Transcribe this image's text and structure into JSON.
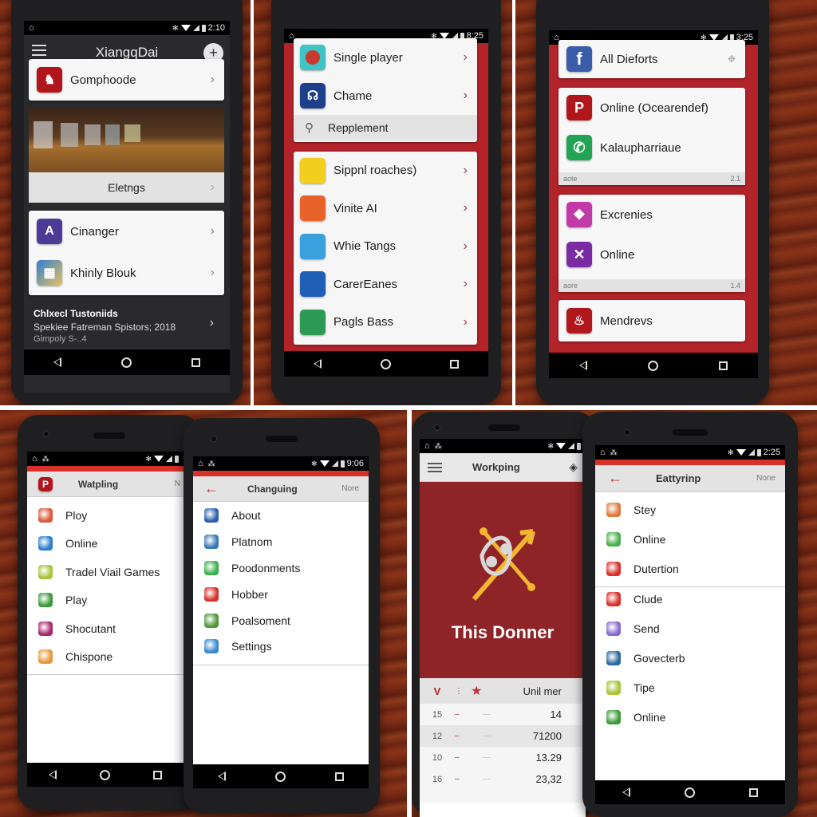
{
  "phones": {
    "p1": {
      "status": {
        "time": "2:10"
      },
      "header": {
        "title": "XiangqDai",
        "add_label": "+"
      },
      "top_item": {
        "label": "Gomphoode",
        "icon": "game-logo-icon"
      },
      "banner_button": {
        "label": "Eletngs"
      },
      "list": [
        {
          "label": "Cinanger",
          "icon": "compass-icon"
        },
        {
          "label": "Khinly Blouk",
          "icon": "board-icon"
        }
      ],
      "footer": {
        "title": "Chlxecl Tustoniids",
        "line1": "Spekiee Fatreman Spistors; 2018",
        "line2": "Gimpoly S-..4"
      }
    },
    "p2": {
      "status": {
        "time": "8:25"
      },
      "group1": [
        {
          "label": "Single player",
          "icon": "single-player-icon",
          "color": "#3ec4c4"
        },
        {
          "label": "Chame",
          "icon": "chame-icon",
          "color": "#1e3f8a"
        }
      ],
      "search_row": {
        "label": "Repplement"
      },
      "group2": [
        {
          "label": "Sippnl roaches)",
          "icon": "person-icon",
          "color": "#f2cf1d"
        },
        {
          "label": "Vinite AI",
          "icon": "cloud-icon",
          "color": "#e8632a"
        },
        {
          "label": "Whie Tangs",
          "icon": "orb-icon",
          "color": "#3aa0de"
        },
        {
          "label": "CarerEanes",
          "icon": "star-icon",
          "color": "#1f5fb5"
        },
        {
          "label": "Pagls Bass",
          "icon": "mountain-icon",
          "color": "#2c9a55"
        }
      ]
    },
    "p3": {
      "status": {
        "time": "3:25"
      },
      "card1": {
        "label": "All Dieforts",
        "icon": "facebook-icon"
      },
      "card2": {
        "items": [
          {
            "label": "Online (Ocearendef)",
            "icon": "p-icon",
            "glyph": "P",
            "color": "#b0161c"
          },
          {
            "label": "Kalaupharriaue",
            "icon": "phone-icon",
            "glyph": "✆",
            "color": "#23a455"
          }
        ],
        "footer_left": "aote",
        "footer_right": "2.1"
      },
      "card3": {
        "items": [
          {
            "label": "Excrenies",
            "icon": "shield-icon",
            "glyph": "❖",
            "color": "#c23aa8"
          },
          {
            "label": "Online",
            "icon": "cross-icon",
            "glyph": "✕",
            "color": "#7a2aa3"
          }
        ],
        "footer_left": "aore",
        "footer_right": "1.4"
      },
      "card4": {
        "label": "Mendrevs",
        "icon": "flame-icon",
        "glyph": "♨",
        "color": "#b0161c"
      }
    },
    "p4": {
      "header": {
        "title": "Watpling",
        "right": "N",
        "logo": "P"
      },
      "list": [
        {
          "label": "Ploy",
          "color": "#d9583a"
        },
        {
          "label": "Online",
          "color": "#2c7fd0"
        },
        {
          "label": "Tradel Viail Games",
          "color": "#a7c43a"
        },
        {
          "label": "Play",
          "color": "#3d9a3a"
        },
        {
          "label": "Shocutant",
          "color": "#a8286b"
        },
        {
          "label": "Chispone",
          "color": "#e89a3a"
        }
      ]
    },
    "p5": {
      "status": {
        "time": "9:06"
      },
      "header": {
        "title": "Changuing",
        "right": "Nore"
      },
      "list": [
        {
          "label": "About",
          "color": "#2c5fb0"
        },
        {
          "label": "Platnom",
          "color": "#3a7ab5"
        },
        {
          "label": "Poodonments",
          "color": "#3bb04d"
        },
        {
          "label": "Hobber",
          "color": "#d9302a"
        },
        {
          "label": "Poalsoment",
          "color": "#4d9a3a"
        },
        {
          "label": "Settings",
          "color": "#3a8ad0"
        }
      ]
    },
    "p6": {
      "header": {
        "title": "Workping"
      },
      "hero": {
        "title": "This Donner"
      },
      "table": {
        "headers": [
          "V",
          "",
          "★",
          "Unil mer"
        ],
        "rows": [
          {
            "rank": "15",
            "value": "14"
          },
          {
            "rank": "12",
            "value": "71200"
          },
          {
            "rank": "10",
            "value": "13.29"
          },
          {
            "rank": "16",
            "value": "23,32"
          }
        ]
      }
    },
    "p7": {
      "status": {
        "time": "2:25"
      },
      "header": {
        "title": "Eattyrinp",
        "right": "None"
      },
      "group1": [
        {
          "label": "Stey",
          "color": "#e07a3a"
        },
        {
          "label": "Online",
          "color": "#4cb04d"
        },
        {
          "label": "Dutertion",
          "color": "#d9302a"
        }
      ],
      "group2": [
        {
          "label": "Clude",
          "color": "#d9302a"
        },
        {
          "label": "Send",
          "color": "#8a6ad0"
        },
        {
          "label": "Govecterb",
          "color": "#2c6a9a"
        },
        {
          "label": "Tipe",
          "color": "#a7c43a"
        },
        {
          "label": "Online",
          "color": "#3d9a3a"
        }
      ]
    }
  },
  "colors": {
    "accent_red": "#b3232a",
    "hero_red": "#8e2328",
    "wood": "#7a2b15"
  }
}
